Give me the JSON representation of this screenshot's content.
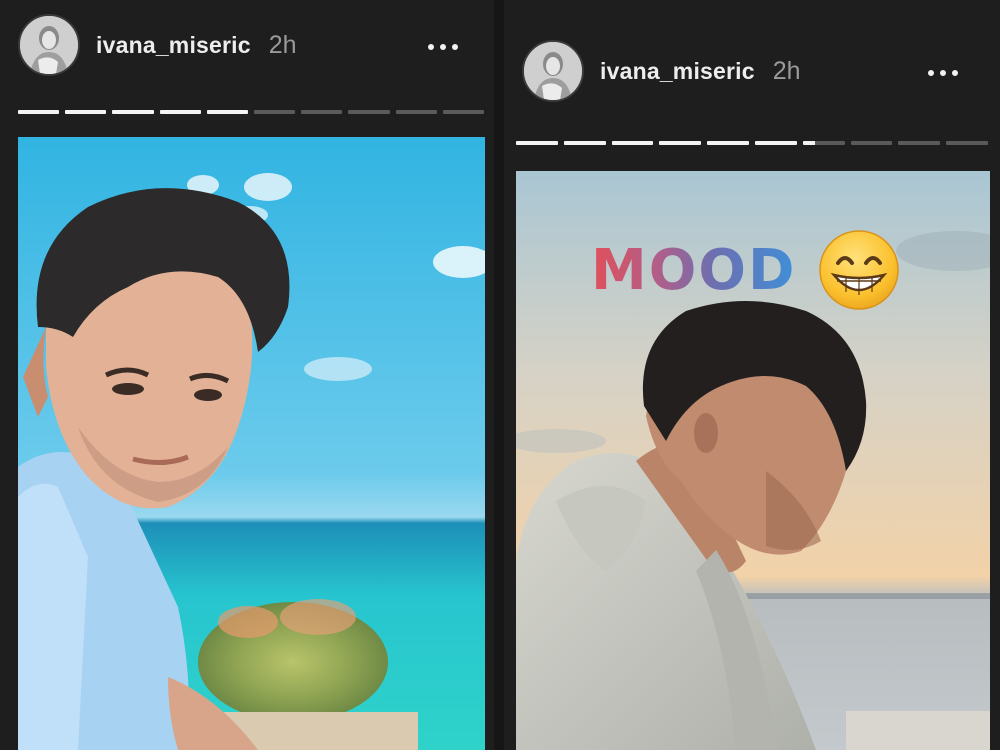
{
  "stories": [
    {
      "username": "ivana_miseric",
      "timestamp": "2h",
      "avatar_icon": "profile-avatar",
      "more_icon": "more-options-icon",
      "progress": {
        "segments": 10,
        "completed": 5,
        "current_fill": 0.0
      }
    },
    {
      "username": "ivana_miseric",
      "timestamp": "2h",
      "avatar_icon": "profile-avatar",
      "more_icon": "more-options-icon",
      "progress": {
        "segments": 10,
        "completed": 6,
        "current_fill": 0.3
      },
      "sticker": {
        "text": "MOOD",
        "emoji": "grinning-face-emoji"
      }
    }
  ],
  "colors": {
    "background": "#1e1e1e",
    "progress_done": "#f3f3f3",
    "progress_pending": "#5a5a5a",
    "username": "#ededed",
    "timestamp": "#9a9a9a"
  }
}
